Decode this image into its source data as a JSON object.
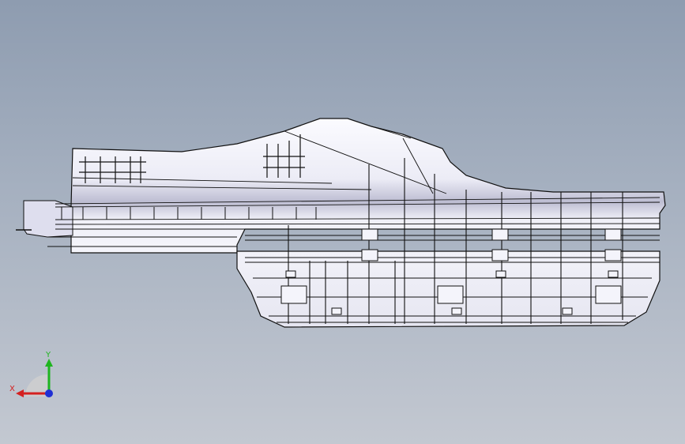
{
  "viewport": {
    "background_top": "#8e9cb0",
    "background_bottom": "#c3c8d1",
    "model": {
      "fill_light": "#f4f4fb",
      "fill_shade": "#c9c9dc",
      "edge_color": "#111111"
    }
  },
  "triad": {
    "x_label": "X",
    "y_label": "Y",
    "x_color": "#d42020",
    "y_color": "#1fb51f",
    "z_color": "#1f2fd4",
    "icons": [
      "x-axis-arrow",
      "y-axis-arrow",
      "z-axis-dot"
    ]
  }
}
